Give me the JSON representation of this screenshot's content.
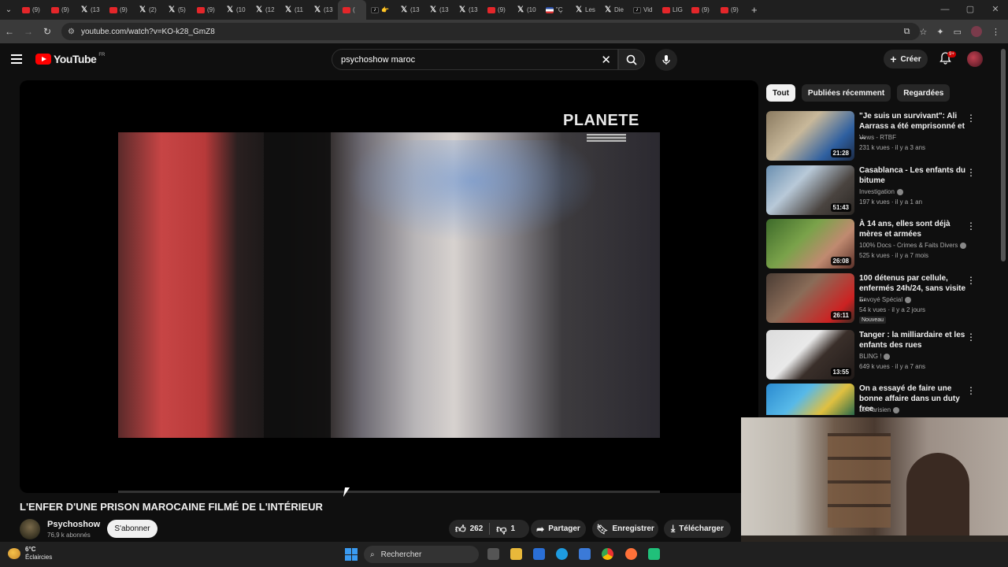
{
  "browser": {
    "tabs": [
      {
        "icon": "youtube",
        "label": "(9)"
      },
      {
        "icon": "youtube",
        "label": "(9)"
      },
      {
        "icon": "x",
        "label": "(13"
      },
      {
        "icon": "youtube",
        "label": "(9)"
      },
      {
        "icon": "x",
        "label": "(2)"
      },
      {
        "icon": "x",
        "label": "(5)"
      },
      {
        "icon": "youtube",
        "label": "(9)"
      },
      {
        "icon": "x",
        "label": "(10"
      },
      {
        "icon": "x",
        "label": "(12"
      },
      {
        "icon": "x",
        "label": "(11"
      },
      {
        "icon": "x",
        "label": "(13"
      },
      {
        "icon": "active",
        "label": "("
      },
      {
        "icon": "tiktok",
        "label": "👉"
      },
      {
        "icon": "x",
        "label": "(13"
      },
      {
        "icon": "x",
        "label": "(13"
      },
      {
        "icon": "x",
        "label": "(13"
      },
      {
        "icon": "youtube",
        "label": "(9)"
      },
      {
        "icon": "x",
        "label": "(10"
      },
      {
        "icon": "flag",
        "label": "\"Ç"
      },
      {
        "icon": "x",
        "label": "Les"
      },
      {
        "icon": "x",
        "label": "Die"
      },
      {
        "icon": "tiktok",
        "label": "Vid"
      },
      {
        "icon": "youtube",
        "label": "LIG"
      },
      {
        "icon": "youtube",
        "label": "(9)"
      },
      {
        "icon": "youtube",
        "label": "(9)"
      }
    ],
    "url": "youtube.com/watch?v=KO-k28_GmZ8"
  },
  "header": {
    "logo_text": "YouTube",
    "logo_country": "FR",
    "search_value": "psychoshow maroc",
    "create_label": "Créer",
    "notif_badge": "9+"
  },
  "video": {
    "watermark": "PLANETE",
    "title": "L'ENFER D'UNE PRISON MAROCAINE FILMÉ DE L'INTÉRIEUR",
    "channel": "Psychoshow",
    "subscribers": "76,9 k abonnés",
    "subscribe_label": "S'abonner",
    "likes": "262",
    "dislikes": "1",
    "share_label": "Partager",
    "save_label": "Enregistrer",
    "download_label": "Télécharger"
  },
  "filters": [
    "Tout",
    "Publiées récemment",
    "Regardées"
  ],
  "recommendations": [
    {
      "title": "\"Je suis un survivant\": Ali Aarrass a été emprisonné et ...",
      "channel": "Vews - RTBF",
      "verified": false,
      "meta": "231 k vues · il y a 3 ans",
      "duration": "21:28",
      "badge": ""
    },
    {
      "title": "Casablanca - Les enfants du bitume",
      "channel": "Investigation",
      "verified": true,
      "meta": "197 k vues · il y a 1 an",
      "duration": "51:43",
      "badge": ""
    },
    {
      "title": "À 14 ans, elles sont déjà mères et armées",
      "channel": "100% Docs - Crimes & Faits Divers",
      "verified": true,
      "meta": "525 k vues · il y a 7 mois",
      "duration": "26:08",
      "badge": ""
    },
    {
      "title": "100 détenus par cellule, enfermés 24h/24, sans visite ...",
      "channel": "Envoyé Spécial",
      "verified": true,
      "meta": "54 k vues · il y a 2 jours",
      "duration": "26:11",
      "badge": "Nouveau"
    },
    {
      "title": "Tanger : la milliardaire et les enfants des rues",
      "channel": "BLING !",
      "verified": true,
      "meta": "649 k vues · il y a 7 ans",
      "duration": "13:55",
      "badge": ""
    },
    {
      "title": "On a essayé de faire une bonne affaire dans un duty free",
      "channel": "Le Parisien",
      "verified": true,
      "meta": "",
      "duration": "",
      "badge": ""
    }
  ],
  "taskbar": {
    "temp": "6°C",
    "weather": "Éclaircies",
    "search_label": "Rechercher"
  },
  "colors": {
    "accent_red": "#ff0000",
    "background": "#0f0f0f",
    "chip_bg": "#272727"
  }
}
